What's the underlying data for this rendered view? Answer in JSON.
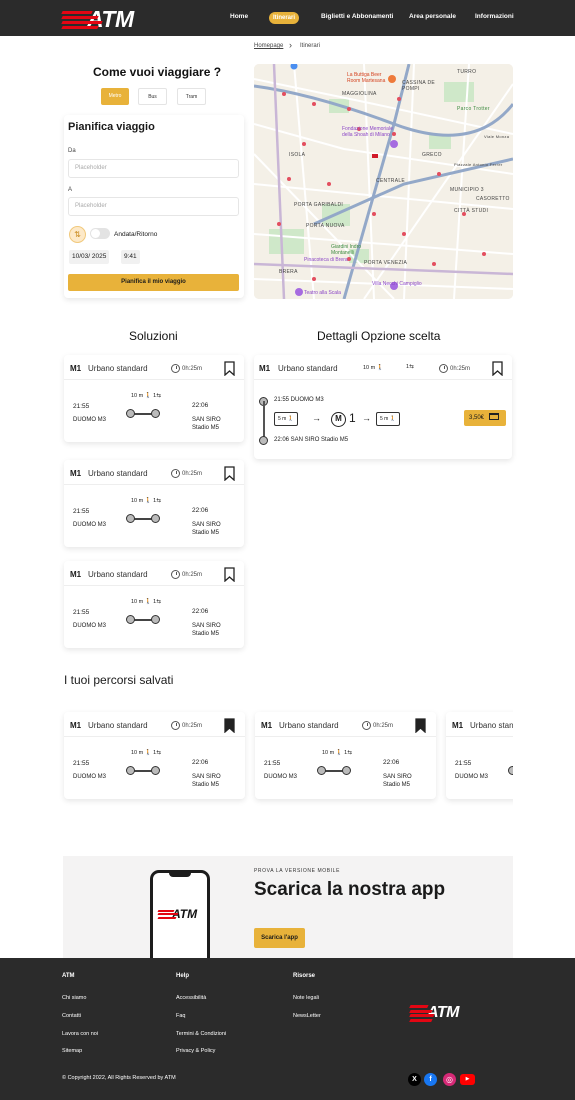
{
  "header": {
    "logo": "ATM",
    "nav": [
      "Home",
      "Itinerari",
      "Biglietti e Abbonamenti",
      "Area personale",
      "Informazioni"
    ]
  },
  "breadcrumb": {
    "home": "Homepage",
    "separator": "›",
    "current": "Itinerari"
  },
  "planner": {
    "question": "Come vuoi viaggiare ?",
    "modes": [
      "Metro",
      "Bus",
      "Tram"
    ],
    "title": "Pianifica viaggio",
    "from_label": "Da",
    "from_placeholder": "Placeholder",
    "to_label": "A",
    "to_placeholder": "Placeholder",
    "swap_icon": "⇅",
    "toggle_label": "Andata/Ritorno",
    "date": "10/03/ 2025",
    "time": "9:41",
    "submit": "Pianifica il mio viaggio"
  },
  "map": {
    "labels": [
      "MAGGIOLINA",
      "TURRO",
      "CASSINA DE POMPI",
      "ISOLA",
      "GRECO",
      "CENTRALE",
      "MUNICIPIO 3",
      "PORTA GARIBALDI",
      "CASORETTO",
      "CITTÀ STUDI",
      "PORTA NUOVA",
      "PORTA VENEZIA",
      "BRERA",
      "Parco Trotter",
      "Viale Monza",
      "Piazzale Antonio Ferrer"
    ],
    "pois": [
      "La Buttiga Beer Room Martesana",
      "Fondazione Memoriale della Shoah di Milano",
      "Giardini Indro Montanelli",
      "Pinacoteca di Brera",
      "Villa Necchi Campiglio",
      "Teatro alla Scala"
    ]
  },
  "solutions": {
    "title": "Soluzioni",
    "items": [
      {
        "line": "M1",
        "type": "Urbano standard",
        "duration": "0h:25m",
        "walk": "10 m",
        "changes": "1",
        "dep_time": "21:55",
        "dep_stop": "DUOMO M3",
        "arr_time": "22:06",
        "arr_stop_1": "SAN SIRO",
        "arr_stop_2": "Stadio M5"
      },
      {
        "line": "M1",
        "type": "Urbano standard",
        "duration": "0h:25m",
        "walk": "10 m",
        "changes": "1",
        "dep_time": "21:55",
        "dep_stop": "DUOMO M3",
        "arr_time": "22:06",
        "arr_stop_1": "SAN SIRO",
        "arr_stop_2": "Stadio M5"
      },
      {
        "line": "M1",
        "type": "Urbano standard",
        "duration": "0h:25m",
        "walk": "10 m",
        "changes": "1",
        "dep_time": "21:55",
        "dep_stop": "DUOMO M3",
        "arr_time": "22:06",
        "arr_stop_1": "SAN SIRO",
        "arr_stop_2": "Stadio M5"
      }
    ]
  },
  "details": {
    "title": "Dettagli  Opzione scelta",
    "line": "M1",
    "type": "Urbano standard",
    "walk": "10 m",
    "changes": "1",
    "duration": "0h:25m",
    "dep": "21:55  DUOMO M3",
    "walk_before": "5 m",
    "arrow": "→",
    "metro_letter": "M",
    "metro_line": "1",
    "walk_after": "5 m",
    "arr": "22:06 SAN SIRO Stadio M5",
    "price": "3,50€"
  },
  "saved": {
    "title": "I tuoi percorsi salvati",
    "items": [
      {
        "line": "M1",
        "type": "Urbano standard",
        "duration": "0h:25m",
        "walk": "10 m",
        "changes": "1",
        "dep_time": "21:55",
        "dep_stop": "DUOMO M3",
        "arr_time": "22:06",
        "arr_stop_1": "SAN SIRO",
        "arr_stop_2": "Stadio M5"
      },
      {
        "line": "M1",
        "type": "Urbano standard",
        "duration": "0h:25m",
        "walk": "10 m",
        "changes": "1",
        "dep_time": "21:55",
        "dep_stop": "DUOMO M3",
        "arr_time": "22:06",
        "arr_stop_1": "SAN SIRO",
        "arr_stop_2": "Stadio M5"
      },
      {
        "line": "M1",
        "type": "Urbano standard",
        "dep_time": "21:55",
        "dep_stop": "DUOMO M3"
      }
    ]
  },
  "banner": {
    "eyebrow": "PROVA LA VERSIONE MOBILE",
    "title": "Scarica la nostra app",
    "button": "Scarica l'app",
    "phone_logo": "ATM"
  },
  "footer": {
    "columns": [
      {
        "title": "ATM",
        "links": [
          "Chi siamo",
          "Contatti",
          "Lavora con noi",
          "Sitemap"
        ]
      },
      {
        "title": "Help",
        "links": [
          "Accessibilità",
          "Faq",
          "Termini & Condizioni",
          "Privacy & Policy"
        ]
      },
      {
        "title": "Risorse",
        "links": [
          "Note legali",
          "NewsLetter"
        ]
      }
    ],
    "logo": "ATM",
    "copyright": "© Copyright 2022, All Rights Reserved by ATM",
    "social": [
      {
        "name": "x-icon",
        "glyph": "X",
        "color": "#000000"
      },
      {
        "name": "facebook-icon",
        "glyph": "f",
        "color": "#1877f2"
      },
      {
        "name": "instagram-icon",
        "glyph": "◎",
        "color": "#d62976"
      },
      {
        "name": "youtube-icon",
        "glyph": "▶",
        "color": "#ff0000"
      }
    ]
  },
  "colors": {
    "accent": "#e8b23a",
    "brand_red": "#e30613",
    "dark": "#2b2b2b"
  }
}
